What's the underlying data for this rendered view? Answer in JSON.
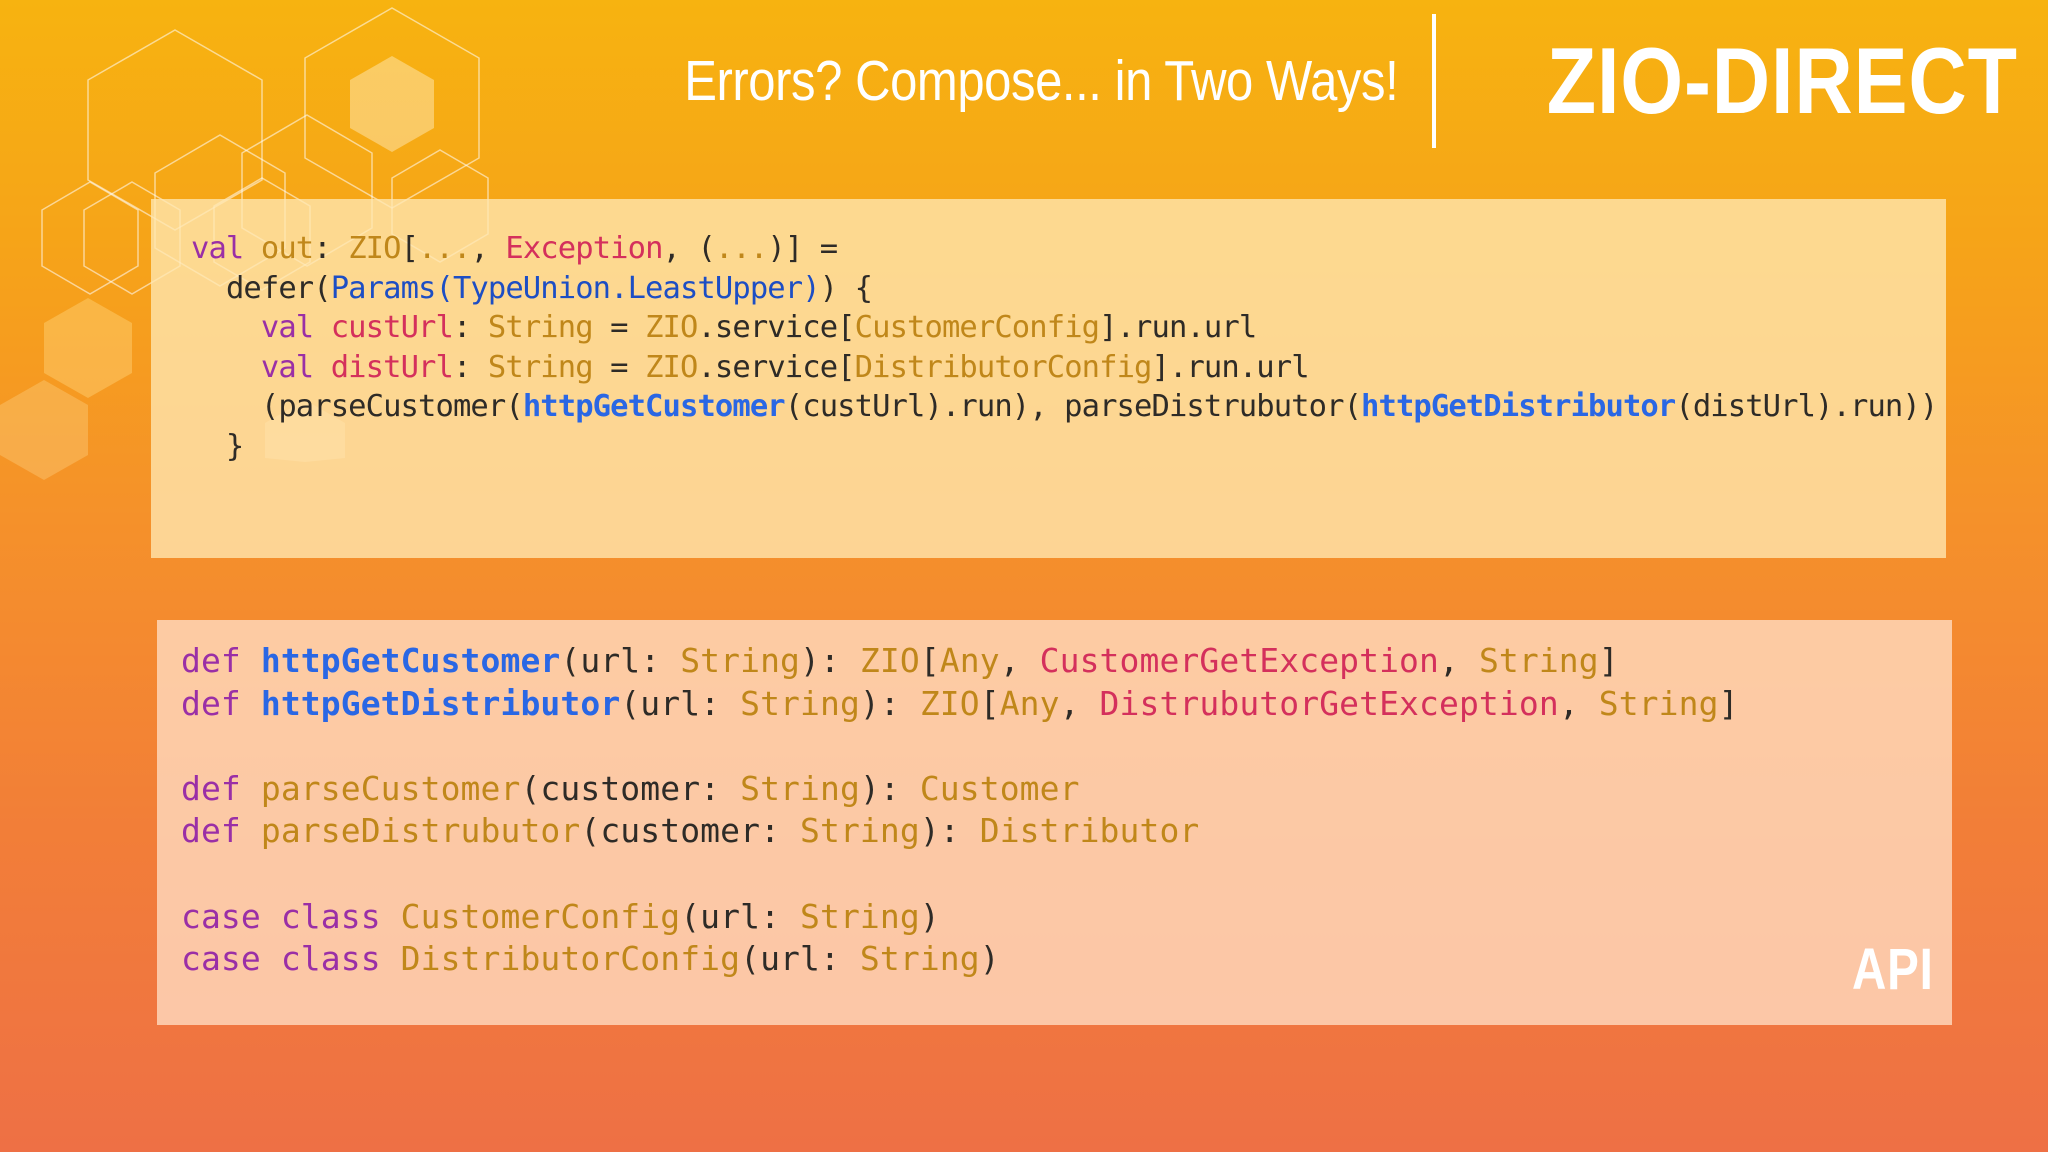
{
  "header": {
    "title": "Errors? Compose... in Two Ways!",
    "brand": "ZIO-DIRECT"
  },
  "colors": {
    "background_top": "#f7b310",
    "background_bottom": "#ee7045",
    "keyword": "#9a2fa6",
    "type": "#c0871a",
    "name": "#d4305c",
    "param": "#1d4ec4",
    "function": "#2a67e4"
  },
  "decoration": {
    "icon": "hexagon-pattern-icon"
  },
  "code_top": {
    "line1": {
      "kw": "val",
      "name": "out",
      "colon": ": ",
      "zio": "ZIO",
      "open": "[",
      "dots1": "...",
      "c1": ", ",
      "exception": "Exception",
      "c2": ", ",
      "paren_open": "(",
      "dots2": "...",
      "paren_close": ")",
      "close": "]",
      "eq": " ="
    },
    "line2": {
      "indent": "  ",
      "defer": "defer(",
      "params": "Params(TypeUnion.LeastUpper)",
      "close": ") {"
    },
    "line3": {
      "indent": "    ",
      "kw": "val",
      "name": "custUrl",
      "colon": ": ",
      "type": "String",
      "eq": " = ",
      "zio": "ZIO",
      "service": ".service[",
      "config": "CustomerConfig",
      "tail": "].run.url"
    },
    "line4": {
      "indent": "    ",
      "kw": "val",
      "name": "distUrl",
      "colon": ": ",
      "type": "String",
      "eq": " = ",
      "zio": "ZIO",
      "service": ".service[",
      "config": "DistributorConfig",
      "tail": "].run.url"
    },
    "line5": {
      "indent": "    ",
      "a": "(parseCustomer(",
      "fn1": "httpGetCustomer",
      "b": "(custUrl).run), parseDistrubutor(",
      "fn2": "httpGetDistributor",
      "c": "(distUrl).run))"
    },
    "line6": {
      "text": "  }"
    }
  },
  "code_bottom": {
    "line1": {
      "kw": "def",
      "fn": "httpGetCustomer",
      "a": "(url: ",
      "type": "String",
      "b": "): ",
      "zio": "ZIO",
      "open": "[",
      "any": "Any",
      "c1": ", ",
      "err": "CustomerGetException",
      "c2": ", ",
      "ret": "String",
      "close": "]"
    },
    "line2": {
      "kw": "def",
      "fn": "httpGetDistributor",
      "a": "(url: ",
      "type": "String",
      "b": "): ",
      "zio": "ZIO",
      "open": "[",
      "any": "Any",
      "c1": ", ",
      "err": "DistrubutorGetException",
      "c2": ", ",
      "ret": "String",
      "close": "]"
    },
    "line3": {
      "kw": "def",
      "fn": "parseCustomer",
      "a": "(customer: ",
      "type": "String",
      "b": "): ",
      "ret": "Customer"
    },
    "line4": {
      "kw": "def",
      "fn": "parseDistrubutor",
      "a": "(customer: ",
      "type": "String",
      "b": "): ",
      "ret": "Distributor"
    },
    "line5": {
      "kw": "case class",
      "cls": "CustomerConfig",
      "a": "(url: ",
      "type": "String",
      "b": ")"
    },
    "line6": {
      "kw": "case class",
      "cls": "DistributorConfig",
      "a": "(url: ",
      "type": "String",
      "b": ")"
    }
  },
  "badge": {
    "label": "API"
  }
}
